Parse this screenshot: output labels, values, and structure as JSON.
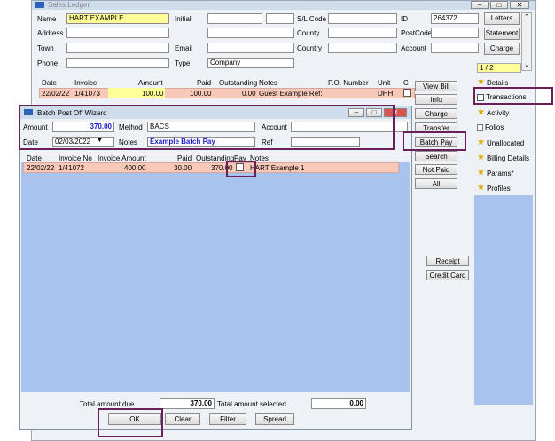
{
  "ledger": {
    "title": "Sales Ledger",
    "labels": {
      "name": "Name",
      "address": "Address",
      "town": "Town",
      "phone": "Phone",
      "initial": "Initial",
      "email": "Email",
      "type": "Type",
      "sl_code": "S/L Code",
      "county1": "County",
      "country": "Country",
      "id": "ID",
      "postcode": "PostCode",
      "account": "Account"
    },
    "values": {
      "name": "HART EXAMPLE",
      "type": "Company",
      "id": "264372"
    },
    "buttons": {
      "letters": "Letters",
      "statement": "Statement",
      "charge": "Charge"
    },
    "page_indicator": "1 / 2",
    "table": {
      "headers": [
        "Date",
        "Invoice",
        "Amount",
        "Paid",
        "Outstanding",
        "Notes",
        "P.O. Number",
        "Unit",
        "C"
      ],
      "row": [
        "22/02/22",
        "1/41073",
        "100.00",
        "100.00",
        "0.00",
        "Guest Example Ref:",
        "",
        "DHH"
      ]
    },
    "side_buttons": [
      "View Bill",
      "Info",
      "Charge",
      "Transfer",
      "Batch Pay",
      "Search",
      "Not Paid",
      "All"
    ],
    "lower_buttons": [
      "Receipt",
      "Credit Card"
    ],
    "nav": [
      "Details",
      "Transactions",
      "Activity",
      "Folios",
      "Unallocated",
      "Billing Details",
      "Params*",
      "Profiles"
    ]
  },
  "wizard": {
    "title": "Batch Post Off Wizard",
    "labels": {
      "amount": "Amount",
      "method": "Method",
      "account": "Account",
      "date": "Date",
      "notes": "Notes",
      "ref": "Ref"
    },
    "values": {
      "amount": "370.00",
      "method": "BACS",
      "date": "02/03/2022",
      "notes": "Example Batch Pay"
    },
    "table": {
      "headers": [
        "Date",
        "Invoice No",
        "Invoice Amount",
        "Paid",
        "Outstanding",
        "Pay",
        "Notes"
      ],
      "row": [
        "22/02/22",
        "1/41072",
        "400.00",
        "30.00",
        "370.00",
        "",
        "HART Example 1"
      ]
    },
    "footer": {
      "total_due_label": "Total amount due",
      "total_due": "370.00",
      "total_selected_label": "Total amount selected",
      "total_selected": "0.00"
    },
    "buttons": {
      "ok": "OK",
      "clear": "Clear",
      "filter": "Filter",
      "spread": "Spread"
    }
  },
  "colors": {
    "highlight": "#6b1f5a",
    "title_bar": "#cfdcec",
    "pink_row": "#f8c8b8",
    "blue_panel": "#a8c4ee",
    "yellow_field": "#ffff99"
  }
}
